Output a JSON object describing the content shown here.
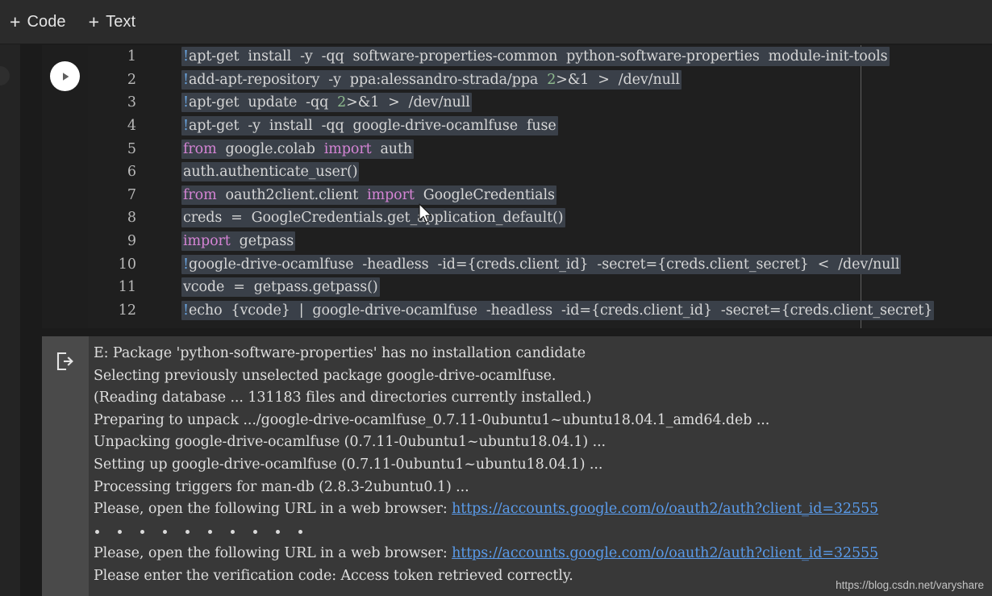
{
  "toolbar": {
    "add_code_plus": "+",
    "add_code_label": "Code",
    "add_text_plus": "+",
    "add_text_label": "Text"
  },
  "code_cell": {
    "run_icon": "play-icon",
    "line_numbers": [
      "1",
      "2",
      "3",
      "4",
      "5",
      "6",
      "7",
      "8",
      "9",
      "10",
      "11",
      "12"
    ],
    "lines": [
      {
        "n": "1",
        "segments": [
          {
            "t": "!",
            "c": "bang"
          },
          {
            "t": "apt-get  install  -y  -qq  software-properties-common  python-software-properties  module-init-tools",
            "c": "plain"
          }
        ]
      },
      {
        "n": "2",
        "segments": [
          {
            "t": "!",
            "c": "bang"
          },
          {
            "t": "add-apt-repository  -y  ppa:alessandro-strada/ppa  ",
            "c": "plain"
          },
          {
            "t": "2",
            "c": "num"
          },
          {
            "t": ">&1  >  /dev/null",
            "c": "plain"
          }
        ]
      },
      {
        "n": "3",
        "segments": [
          {
            "t": "!",
            "c": "bang"
          },
          {
            "t": "apt-get  update  -qq  ",
            "c": "plain"
          },
          {
            "t": "2",
            "c": "num"
          },
          {
            "t": ">&1  >  /dev/null",
            "c": "plain"
          }
        ]
      },
      {
        "n": "4",
        "segments": [
          {
            "t": "!",
            "c": "bang"
          },
          {
            "t": "apt-get  -y  install  -qq  google-drive-ocamlfuse  fuse",
            "c": "plain"
          }
        ]
      },
      {
        "n": "5",
        "segments": [
          {
            "t": "from",
            "c": "kw"
          },
          {
            "t": "  google.colab  ",
            "c": "plain"
          },
          {
            "t": "import",
            "c": "kw"
          },
          {
            "t": "  auth",
            "c": "plain"
          }
        ]
      },
      {
        "n": "6",
        "segments": [
          {
            "t": "auth.authenticate_user()",
            "c": "plain"
          }
        ]
      },
      {
        "n": "7",
        "segments": [
          {
            "t": "from",
            "c": "kw"
          },
          {
            "t": "  oauth2client.client  ",
            "c": "plain"
          },
          {
            "t": "import",
            "c": "kw"
          },
          {
            "t": "  GoogleCredentials",
            "c": "plain"
          }
        ]
      },
      {
        "n": "8",
        "segments": [
          {
            "t": "creds  =  GoogleCredentials.get_application_default()",
            "c": "plain"
          }
        ]
      },
      {
        "n": "9",
        "segments": [
          {
            "t": "import",
            "c": "kw"
          },
          {
            "t": "  getpass",
            "c": "plain"
          }
        ]
      },
      {
        "n": "10",
        "segments": [
          {
            "t": "!",
            "c": "bang"
          },
          {
            "t": "google-drive-ocamlfuse  -headless  -id={creds.client_id}  -secret={creds.client_secret}  <  /dev/null",
            "c": "plain"
          }
        ]
      },
      {
        "n": "11",
        "segments": [
          {
            "t": "vcode  =  getpass.getpass()",
            "c": "plain"
          }
        ]
      },
      {
        "n": "12",
        "segments": [
          {
            "t": "!",
            "c": "bang"
          },
          {
            "t": "echo  {vcode}  |  google-drive-ocamlfuse  -headless  -id={creds.client_id}  -secret={creds.client_secret}",
            "c": "plain"
          }
        ]
      }
    ]
  },
  "output_cell": {
    "output_icon": "output-arrow-icon",
    "lines": [
      {
        "type": "text",
        "text": "E: Package 'python-software-properties' has no installation candidate"
      },
      {
        "type": "text",
        "text": "Selecting previously unselected package google-drive-ocamlfuse."
      },
      {
        "type": "text",
        "text": "(Reading database ... 131183 files and directories currently installed.)"
      },
      {
        "type": "text",
        "text": "Preparing to unpack .../google-drive-ocamlfuse_0.7.11-0ubuntu1~ubuntu18.04.1_amd64.deb ..."
      },
      {
        "type": "text",
        "text": "Unpacking google-drive-ocamlfuse (0.7.11-0ubuntu1~ubuntu18.04.1) ..."
      },
      {
        "type": "text",
        "text": "Setting up google-drive-ocamlfuse (0.7.11-0ubuntu1~ubuntu18.04.1) ..."
      },
      {
        "type": "text",
        "text": "Processing triggers for man-db (2.8.3-2ubuntu0.1) ..."
      },
      {
        "type": "link",
        "text": "Please, open the following URL in a web browser: ",
        "link": "https://accounts.google.com/o/oauth2/auth?client_id=32555"
      },
      {
        "type": "dots",
        "count": 10
      },
      {
        "type": "link",
        "text": "Please, open the following URL in a web browser: ",
        "link": "https://accounts.google.com/o/oauth2/auth?client_id=32555"
      },
      {
        "type": "text",
        "text": "Please enter the verification code: Access token retrieved correctly."
      }
    ]
  },
  "watermark": {
    "text": "https://blog.csdn.net/varyshare"
  },
  "colors": {
    "toolbar_bg": "#2b2b2b",
    "code_bg": "#1f1f1f",
    "selection_bg": "#3a4049",
    "output_bg": "#383838",
    "output_gutter_bg": "#4a4a4a",
    "keyword": "#d584d5",
    "bang": "#6aa5e0",
    "number": "#8fbc8f",
    "link": "#5a9bea"
  }
}
